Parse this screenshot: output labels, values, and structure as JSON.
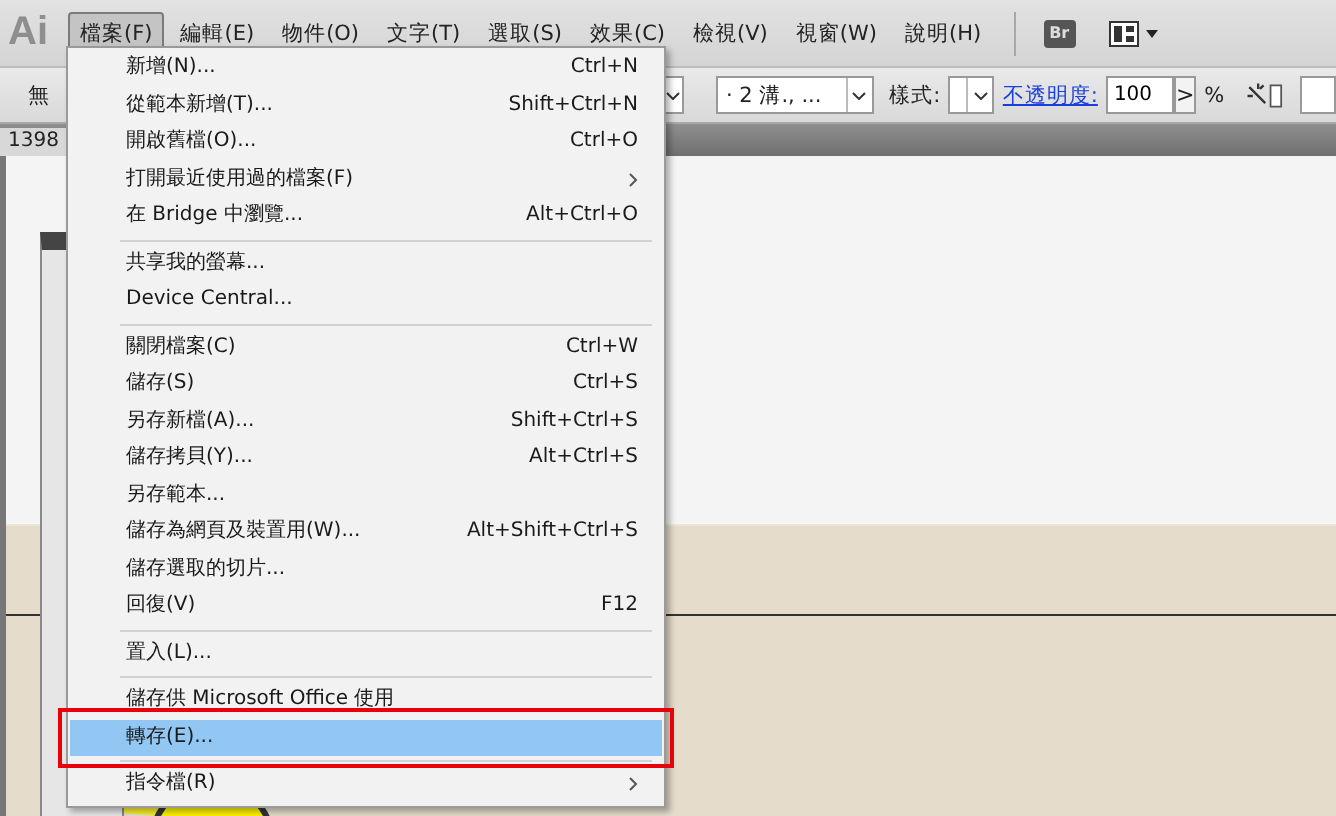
{
  "app_logo": "Ai",
  "menu_bar": [
    {
      "label": "檔案(F)",
      "selected": true
    },
    {
      "label": "編輯(E)",
      "selected": false
    },
    {
      "label": "物件(O)",
      "selected": false
    },
    {
      "label": "文字(T)",
      "selected": false
    },
    {
      "label": "選取(S)",
      "selected": false
    },
    {
      "label": "效果(C)",
      "selected": false
    },
    {
      "label": "檢視(V)",
      "selected": false
    },
    {
      "label": "視窗(W)",
      "selected": false
    },
    {
      "label": "說明(H)",
      "selected": false
    }
  ],
  "bridge_button": "Br",
  "control_bar": {
    "selection_label": "無",
    "brush": "· 2 溝., ...",
    "style_label": "樣式:",
    "opacity_label": "不透明度:",
    "opacity_value": "100",
    "opacity_arrow": ">",
    "percent": "%"
  },
  "document_tab": "1398",
  "file_menu": [
    {
      "kind": "item",
      "label": "新增(N)...",
      "shortcut": "Ctrl+N",
      "submenu": false,
      "selected": false
    },
    {
      "kind": "item",
      "label": "從範本新增(T)...",
      "shortcut": "Shift+Ctrl+N",
      "submenu": false,
      "selected": false
    },
    {
      "kind": "item",
      "label": "開啟舊檔(O)...",
      "shortcut": "Ctrl+O",
      "submenu": false,
      "selected": false
    },
    {
      "kind": "item",
      "label": "打開最近使用過的檔案(F)",
      "submenu": true,
      "selected": false
    },
    {
      "kind": "item",
      "label": "在 Bridge 中瀏覽...",
      "shortcut": "Alt+Ctrl+O",
      "submenu": false,
      "selected": false
    },
    {
      "kind": "separator"
    },
    {
      "kind": "item",
      "label": "共享我的螢幕...",
      "submenu": false,
      "selected": false
    },
    {
      "kind": "item",
      "label": "Device Central...",
      "submenu": false,
      "selected": false
    },
    {
      "kind": "separator"
    },
    {
      "kind": "item",
      "label": "關閉檔案(C)",
      "shortcut": "Ctrl+W",
      "submenu": false,
      "selected": false
    },
    {
      "kind": "item",
      "label": "儲存(S)",
      "shortcut": "Ctrl+S",
      "submenu": false,
      "selected": false
    },
    {
      "kind": "item",
      "label": "另存新檔(A)...",
      "shortcut": "Shift+Ctrl+S",
      "submenu": false,
      "selected": false
    },
    {
      "kind": "item",
      "label": "儲存拷貝(Y)...",
      "shortcut": "Alt+Ctrl+S",
      "submenu": false,
      "selected": false
    },
    {
      "kind": "item",
      "label": "另存範本...",
      "submenu": false,
      "selected": false
    },
    {
      "kind": "item",
      "label": "儲存為網頁及裝置用(W)...",
      "shortcut": "Alt+Shift+Ctrl+S",
      "submenu": false,
      "selected": false
    },
    {
      "kind": "item",
      "label": "儲存選取的切片...",
      "submenu": false,
      "selected": false
    },
    {
      "kind": "item",
      "label": "回復(V)",
      "shortcut": "F12",
      "submenu": false,
      "selected": false
    },
    {
      "kind": "separator"
    },
    {
      "kind": "item",
      "label": "置入(L)...",
      "submenu": false,
      "selected": false
    },
    {
      "kind": "separator"
    },
    {
      "kind": "item",
      "label": "儲存供 Microsoft Office 使用",
      "submenu": false,
      "selected": false
    },
    {
      "kind": "item",
      "label": "轉存(E)...",
      "submenu": false,
      "selected": true
    },
    {
      "kind": "separator"
    },
    {
      "kind": "item",
      "label": "指令檔(R)",
      "submenu": true,
      "selected": false
    }
  ]
}
